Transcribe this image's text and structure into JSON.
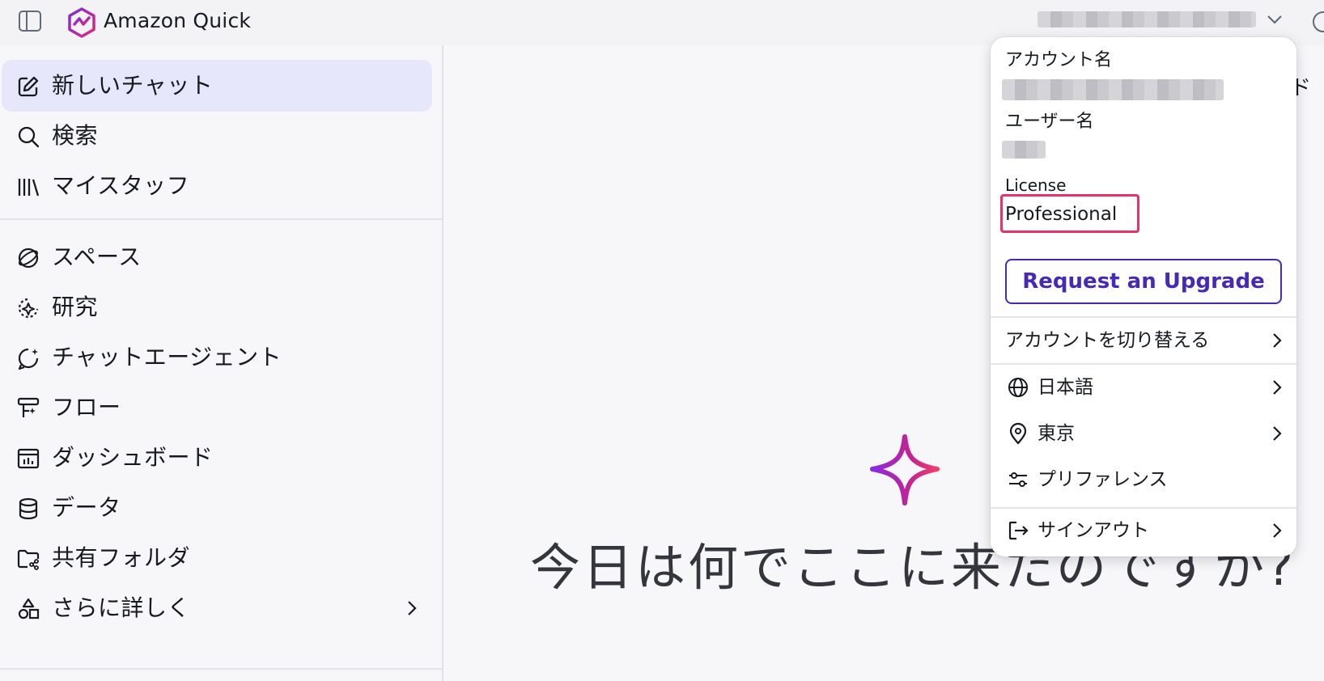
{
  "app": {
    "title": "Amazon Quick"
  },
  "sidebar": {
    "items": [
      {
        "label": "新しいチャット",
        "icon": "edit-icon"
      },
      {
        "label": "検索",
        "icon": "search-icon"
      },
      {
        "label": "マイスタッフ",
        "icon": "library-icon"
      },
      {
        "label": "スペース",
        "icon": "spaces-icon"
      },
      {
        "label": "研究",
        "icon": "research-icon"
      },
      {
        "label": "チャットエージェント",
        "icon": "chat-agent-icon"
      },
      {
        "label": "フロー",
        "icon": "flow-icon"
      },
      {
        "label": "ダッシュボード",
        "icon": "dashboard-icon"
      },
      {
        "label": "データ",
        "icon": "database-icon"
      },
      {
        "label": "共有フォルダ",
        "icon": "shared-folder-icon"
      },
      {
        "label": "さらに詳しく",
        "icon": "shapes-icon"
      }
    ]
  },
  "main": {
    "headline": "今日は何でここに来たのですか?",
    "clipped_text": "ド"
  },
  "account_menu": {
    "account_name_label": "アカウント名",
    "username_label": "ユーザー名",
    "license_label": "License",
    "license_value": "Professional",
    "upgrade_button": "Request an Upgrade",
    "switch_account": "アカウントを切り替える",
    "language": "日本語",
    "region": "東京",
    "preferences": "プリファレンス",
    "sign_out": "サインアウト"
  },
  "colors": {
    "accent": "#4629b5",
    "highlight": "#e8316a",
    "active_bg": "#e7e7fb"
  }
}
